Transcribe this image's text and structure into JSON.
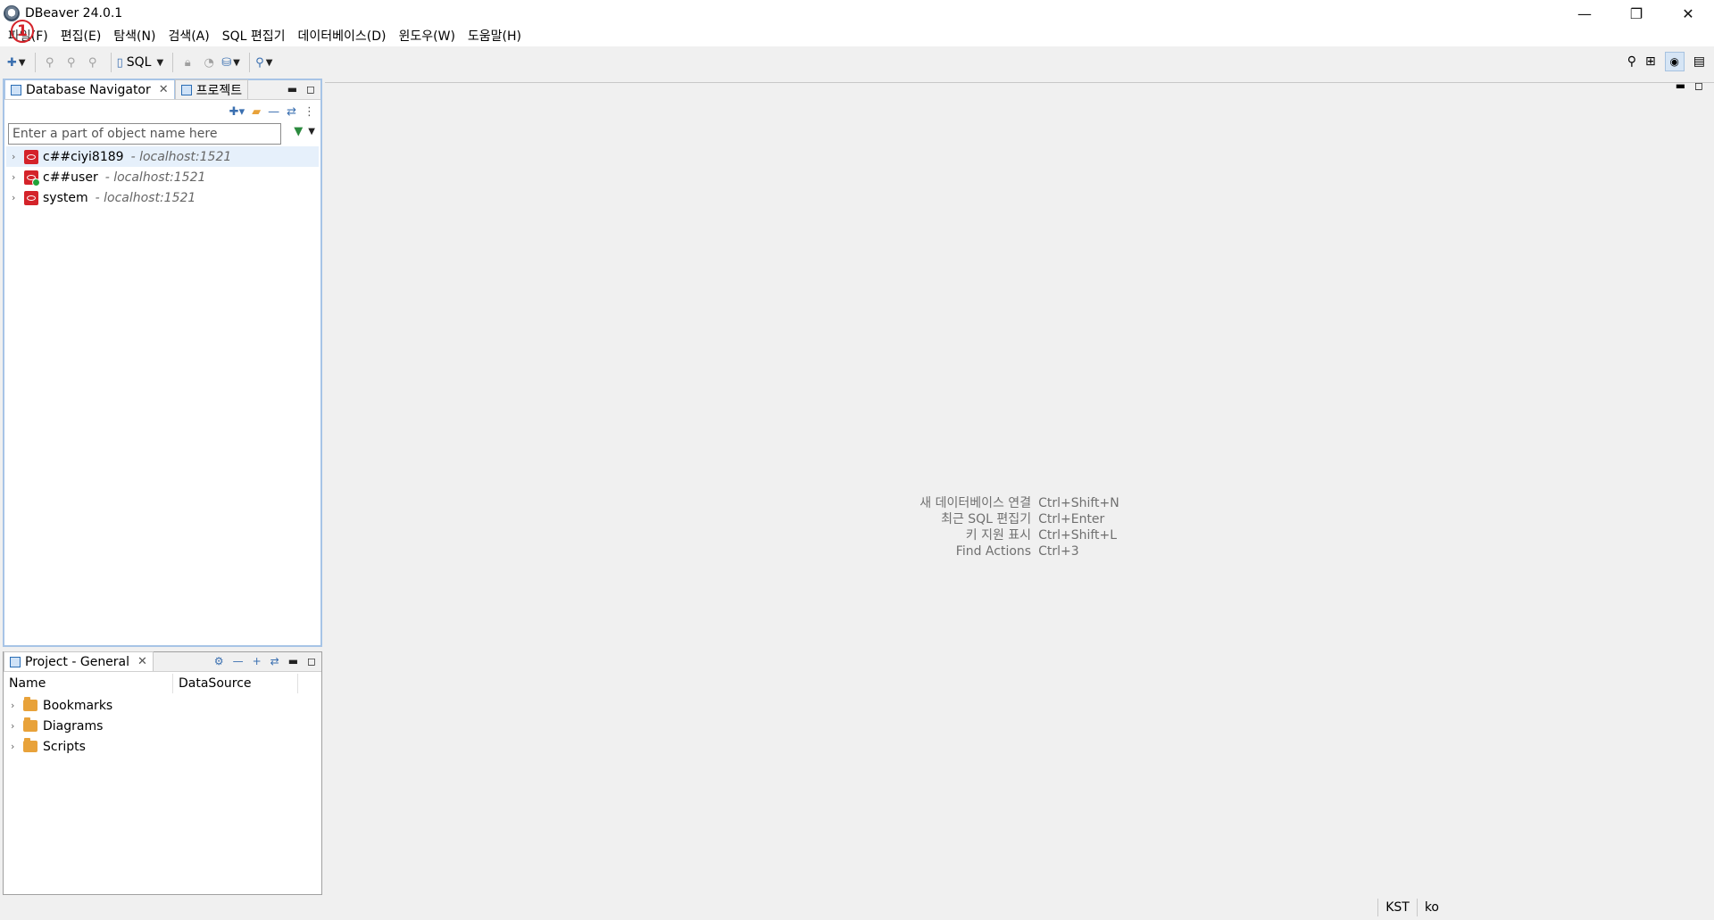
{
  "window": {
    "title": "DBeaver 24.0.1",
    "minimize": "—",
    "maximize": "❐",
    "close": "✕"
  },
  "badge": "1",
  "menu": [
    "파일(F)",
    "편집(E)",
    "탐색(N)",
    "검색(A)",
    "SQL 편집기",
    "데이터베이스(D)",
    "윈도우(W)",
    "도움말(H)"
  ],
  "toolbar": {
    "sql_label": "SQL"
  },
  "navigator": {
    "tabs": [
      {
        "label": "Database Navigator",
        "selected": true
      },
      {
        "label": "프로젝트",
        "selected": false
      }
    ],
    "filter_placeholder": "Enter a part of object name here",
    "connections": [
      {
        "name": "c##ciyi8189",
        "host": "- localhost:1521",
        "connected": false
      },
      {
        "name": "c##user",
        "host": "- localhost:1521",
        "connected": true
      },
      {
        "name": "system",
        "host": "- localhost:1521",
        "connected": false
      }
    ]
  },
  "project": {
    "tab_label": "Project - General",
    "columns": [
      "Name",
      "DataSource"
    ],
    "items": [
      "Bookmarks",
      "Diagrams",
      "Scripts"
    ]
  },
  "editor_hints": {
    "labels": [
      "새 데이터베이스 연결",
      "최근 SQL 편집기",
      "키 지원 표시",
      "Find Actions"
    ],
    "keys": [
      "Ctrl+Shift+N",
      "Ctrl+Enter",
      "Ctrl+Shift+L",
      "Ctrl+3"
    ]
  },
  "status": {
    "timezone": "KST",
    "locale": "ko"
  },
  "colors": {
    "oracle_red": "#d4232a",
    "connected_green": "#22a33a",
    "active_tab_border": "#a7c4e6"
  }
}
